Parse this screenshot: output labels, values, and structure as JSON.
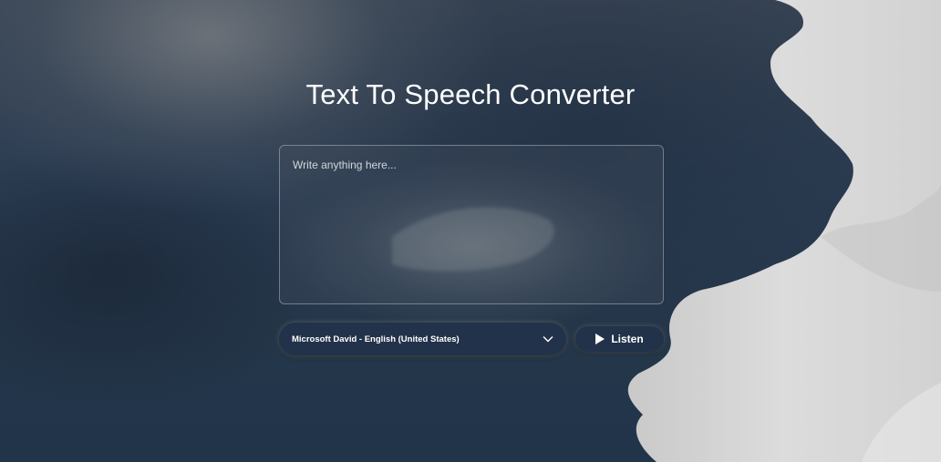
{
  "page": {
    "title": "Text To Speech Converter"
  },
  "input": {
    "placeholder": "Write anything here...",
    "value": ""
  },
  "voice_select": {
    "selected": "Microsoft David - English (United States)"
  },
  "listen_button": {
    "label": "Listen",
    "icon": "play-icon"
  },
  "colors": {
    "control_bg": "#22324a",
    "text": "#ffffff"
  }
}
